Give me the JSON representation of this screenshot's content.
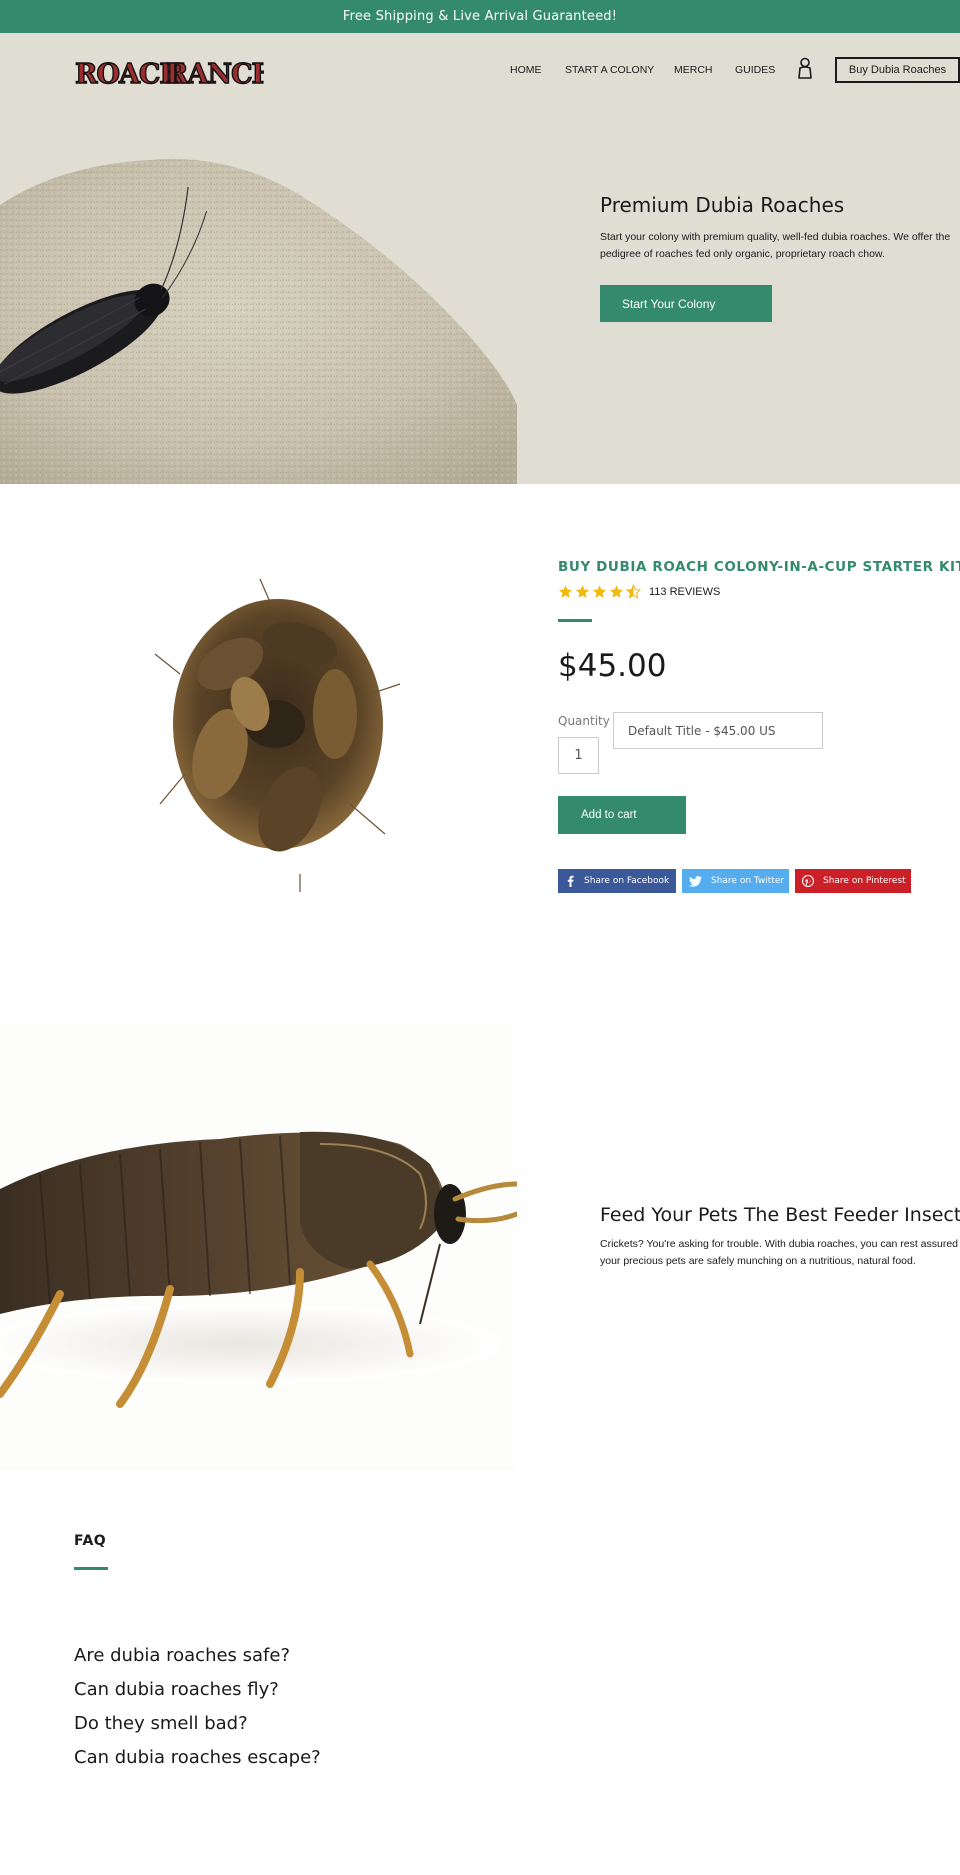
{
  "announcement": {
    "text": "Free Shipping & Live Arrival Guaranteed!"
  },
  "header": {
    "logo_text": "RoachRancher",
    "nav": [
      {
        "label": "HOME"
      },
      {
        "label": "START A COLONY"
      },
      {
        "label": "MERCH"
      },
      {
        "label": "GUIDES"
      }
    ],
    "account_icon": "person-icon",
    "buy_button": "Buy Dubia Roaches"
  },
  "hero": {
    "title": "Premium Dubia Roaches",
    "description": "Start your colony with premium quality, well-fed dubia roaches. We offer the pedigree of roaches fed only organic, proprietary roach chow.",
    "cta": "Start Your Colony"
  },
  "product": {
    "title": "BUY DUBIA ROACH COLONY-IN-A-CUP STARTER KIT",
    "rating": 4.5,
    "reviews": "113 REVIEWS",
    "price": "$45.00",
    "quantity_label": "Quantity",
    "quantity_value": "1",
    "variant": "Default Title - $45.00 US",
    "add_to_cart": "Add to cart",
    "share": {
      "facebook": "Share on Facebook",
      "twitter": "Share on Twitter",
      "pinterest": "Share on Pinterest"
    }
  },
  "feature": {
    "title": "Feed Your Pets The Best Feeder Insects",
    "description": "Crickets? You're asking for trouble. With dubia roaches, you can rest assured your precious pets are safely munching on a nutritious, natural food."
  },
  "faq": {
    "heading": "FAQ",
    "items": [
      "Are dubia roaches safe?",
      "Can dubia roaches fly?",
      "Do they smell bad?",
      "Can dubia roaches escape?"
    ]
  },
  "colors": {
    "brand_green": "#338a6d",
    "hero_bg": "#e0ddd3",
    "facebook": "#3b5998",
    "twitter": "#55acee",
    "pinterest": "#cb2027",
    "star": "#f0b90b"
  }
}
